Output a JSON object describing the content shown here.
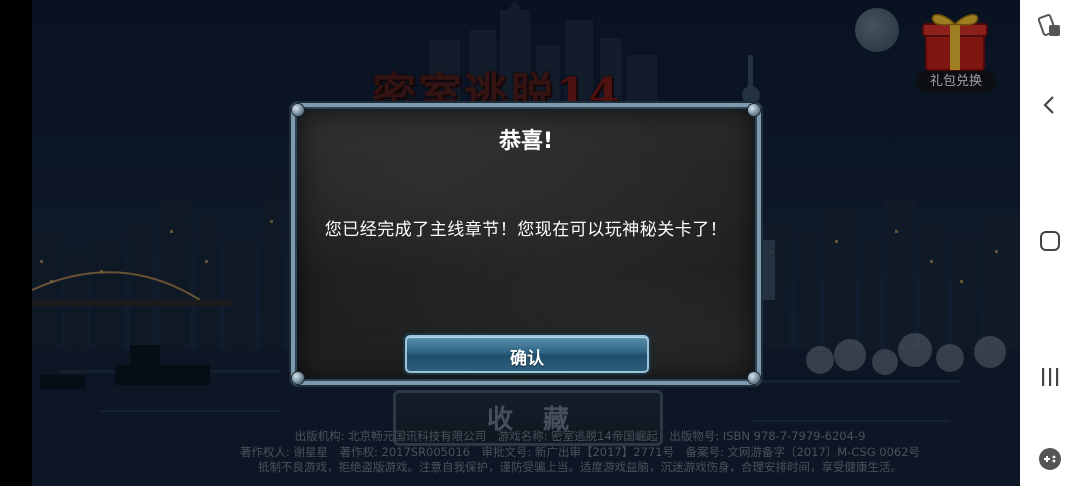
{
  "game": {
    "title_logo": "密室逃脱",
    "title_logo_number": "14",
    "gift_label": "礼包兑换",
    "collect_label": "收藏",
    "footer": {
      "line1": "出版机构: 北京畅元国讯科技有限公司　游戏名称: 密室逃脱14帝国崛起　出版物号: ISBN 978-7-7979-6204-9",
      "line2": "著作权人: 谢星星　著作权: 2017SR005016　审批文号: 新广出审【2017】2771号　备案号: 文网游备字〔2017〕M-CSG 0062号",
      "line3": "抵制不良游戏，拒绝盗版游戏。注意自我保护，谨防受骗上当。适度游戏益脑，沉迷游戏伤身，合理安排时间，享受健康生活。"
    }
  },
  "dialog": {
    "title": "恭喜!",
    "message": "您已经完成了主线章节！您现在可以玩神秘关卡了！",
    "confirm_label": "确认"
  },
  "nav": {
    "icons": [
      "screen-rotate-icon",
      "back-icon",
      "home-icon",
      "recent-apps-icon",
      "game-tools-icon"
    ]
  },
  "colors": {
    "dialog_border": "#7e9aae",
    "confirm_button": "#2f6584",
    "gift_box": "#c4221c",
    "nav_bg": "#ffffff"
  }
}
